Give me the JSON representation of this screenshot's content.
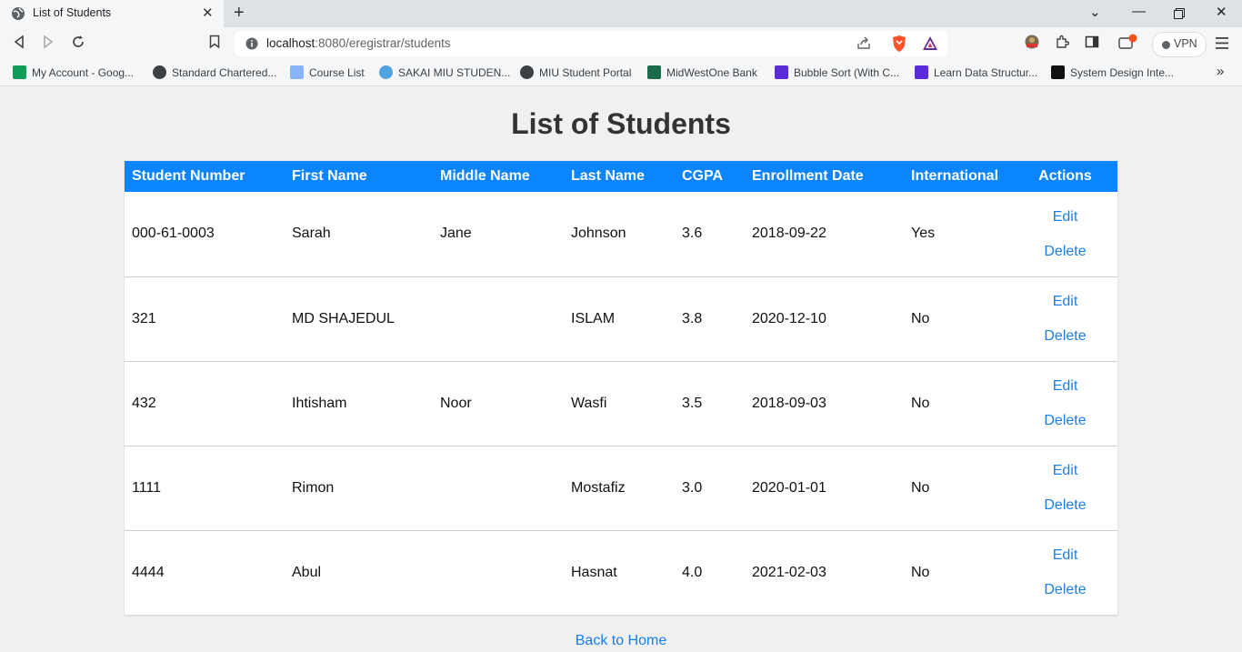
{
  "browser": {
    "tab_title": "List of Students",
    "url_host": "localhost",
    "url_rest": ":8080/eregistrar/students",
    "vpn_label": "VPN",
    "bookmarks": [
      {
        "label": "My Account - Goog...",
        "icon": "sheets-icon",
        "color": "#0f9d58"
      },
      {
        "label": "Standard Chartered...",
        "icon": "globe-icon",
        "color": "#3c4043"
      },
      {
        "label": "Course List",
        "icon": "page-icon",
        "color": "#8ab4f8"
      },
      {
        "label": "SAKAI MIU STUDEN...",
        "icon": "sakai-icon",
        "color": "#4fa3e0"
      },
      {
        "label": "MIU Student Portal",
        "icon": "globe-icon",
        "color": "#3c4043"
      },
      {
        "label": "MidWestOne Bank",
        "icon": "bank-icon",
        "color": "#1b6b4a"
      },
      {
        "label": "Bubble Sort (With C...",
        "icon": "programiz-icon",
        "color": "#5b2bd9"
      },
      {
        "label": "Learn Data Structur...",
        "icon": "programiz-icon",
        "color": "#5b2bd9"
      },
      {
        "label": "System Design Inte...",
        "icon": "sdi-icon",
        "color": "#111111"
      }
    ]
  },
  "page": {
    "title": "List of Students",
    "back_link": "Back to Home"
  },
  "table": {
    "headers": {
      "student_number": "Student Number",
      "first_name": "First Name",
      "middle_name": "Middle Name",
      "last_name": "Last Name",
      "cgpa": "CGPA",
      "enrollment_date": "Enrollment Date",
      "international": "International",
      "actions": "Actions"
    },
    "edit_label": "Edit",
    "delete_label": "Delete",
    "rows": [
      {
        "student_number": "000-61-0003",
        "first_name": "Sarah",
        "middle_name": "Jane",
        "last_name": "Johnson",
        "cgpa": "3.6",
        "enrollment_date": "2018-09-22",
        "international": "Yes"
      },
      {
        "student_number": "321",
        "first_name": "MD SHAJEDUL",
        "middle_name": "",
        "last_name": "ISLAM",
        "cgpa": "3.8",
        "enrollment_date": "2020-12-10",
        "international": "No"
      },
      {
        "student_number": "432",
        "first_name": "Ihtisham",
        "middle_name": "Noor",
        "last_name": "Wasfi",
        "cgpa": "3.5",
        "enrollment_date": "2018-09-03",
        "international": "No"
      },
      {
        "student_number": "1111",
        "first_name": "Rimon",
        "middle_name": "",
        "last_name": "Mostafiz",
        "cgpa": "3.0",
        "enrollment_date": "2020-01-01",
        "international": "No"
      },
      {
        "student_number": "4444",
        "first_name": "Abul",
        "middle_name": "",
        "last_name": "Hasnat",
        "cgpa": "4.0",
        "enrollment_date": "2021-02-03",
        "international": "No"
      }
    ]
  },
  "colors": {
    "header_bg": "#0a84ff",
    "link": "#1a7ee6",
    "page_bg": "#f0f0f0"
  }
}
